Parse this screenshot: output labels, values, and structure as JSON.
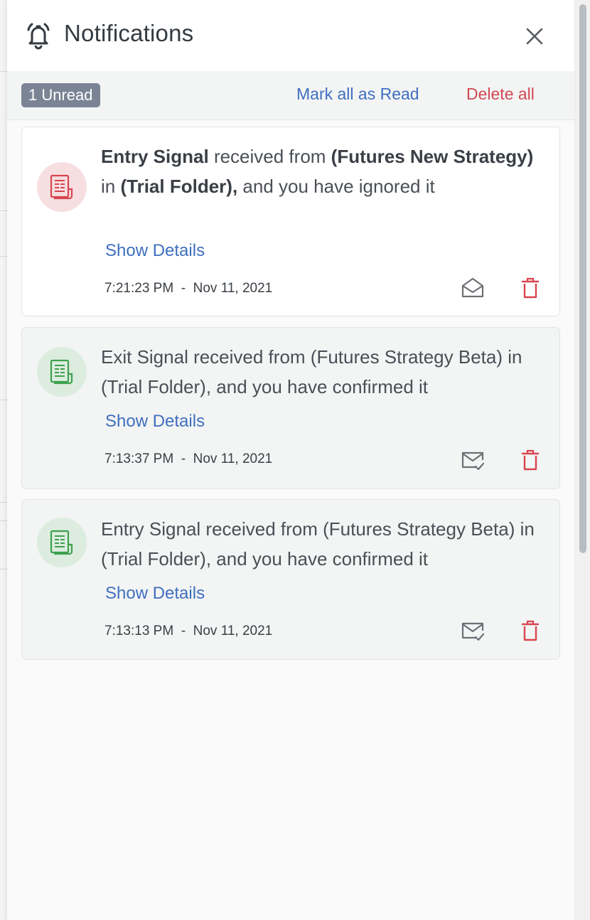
{
  "header": {
    "title": "Notifications"
  },
  "toolbar": {
    "unread_badge": "1 Unread",
    "mark_all_label": "Mark all as Read",
    "delete_all_label": "Delete all"
  },
  "notifications": [
    {
      "state": "unread",
      "icon": "document-icon",
      "icon_color": "#d8454f",
      "type": "Entry Signal",
      "received_text": "received from",
      "strategy": "(Futures New Strategy)",
      "in_text": "in",
      "folder": "(Trial Folder),",
      "result_text": "and you have ignored it",
      "show_details": "Show Details",
      "time": "7:21:23 PM",
      "separator": "-",
      "date": "Nov 11, 2021"
    },
    {
      "state": "read",
      "icon": "document-icon",
      "icon_color": "#3fa04e",
      "message": "Exit Signal received from (Futures Strategy Beta) in (Trial Folder), and you have confirmed it",
      "show_details": "Show Details",
      "time": "7:13:37 PM",
      "separator": "-",
      "date": "Nov 11, 2021"
    },
    {
      "state": "read",
      "icon": "document-icon",
      "icon_color": "#3fa04e",
      "message": "Entry Signal received from (Futures Strategy Beta) in (Trial Folder), and you have confirmed it",
      "show_details": "Show Details",
      "time": "7:13:13 PM",
      "separator": "-",
      "date": "Nov 11, 2021"
    }
  ],
  "colors": {
    "link": "#3f6fbf",
    "danger": "#d04a55",
    "badge": "#7a8494"
  }
}
